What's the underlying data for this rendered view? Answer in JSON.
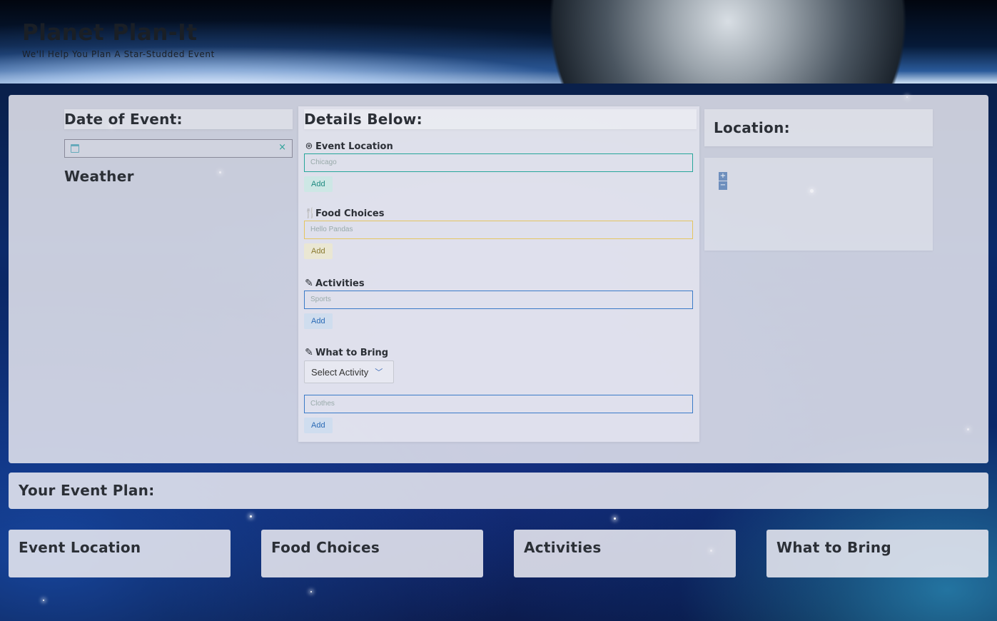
{
  "header": {
    "title": "Planet Plan-It",
    "subtitle": "We'll Help You Plan A Star-Studded Event"
  },
  "left": {
    "date_heading": "Date of Event:",
    "date_value": "",
    "weather_heading": "Weather"
  },
  "details": {
    "heading": "Details Below:",
    "event_location": {
      "label": "Event Location",
      "placeholder": "Chicago",
      "add": "Add"
    },
    "food_choices": {
      "label": "Food Choices",
      "placeholder": "Hello Pandas",
      "add": "Add"
    },
    "activities": {
      "label": "Activities",
      "placeholder": "Sports",
      "add": "Add"
    },
    "what_to_bring": {
      "label": "What to Bring",
      "select": "Select Activity",
      "placeholder": "Clothes",
      "add": "Add"
    }
  },
  "location": {
    "heading": "Location:",
    "zoom_in": "+",
    "zoom_out": "−"
  },
  "plan": {
    "heading": "Your Event Plan:",
    "cards": [
      "Event Location",
      "Food Choices",
      "Activities",
      "What to Bring"
    ]
  },
  "colors": {
    "teal": "#26a69a",
    "yellow": "#e5c560",
    "blue": "#3a7ac8",
    "panel": "#e8e8f0"
  }
}
